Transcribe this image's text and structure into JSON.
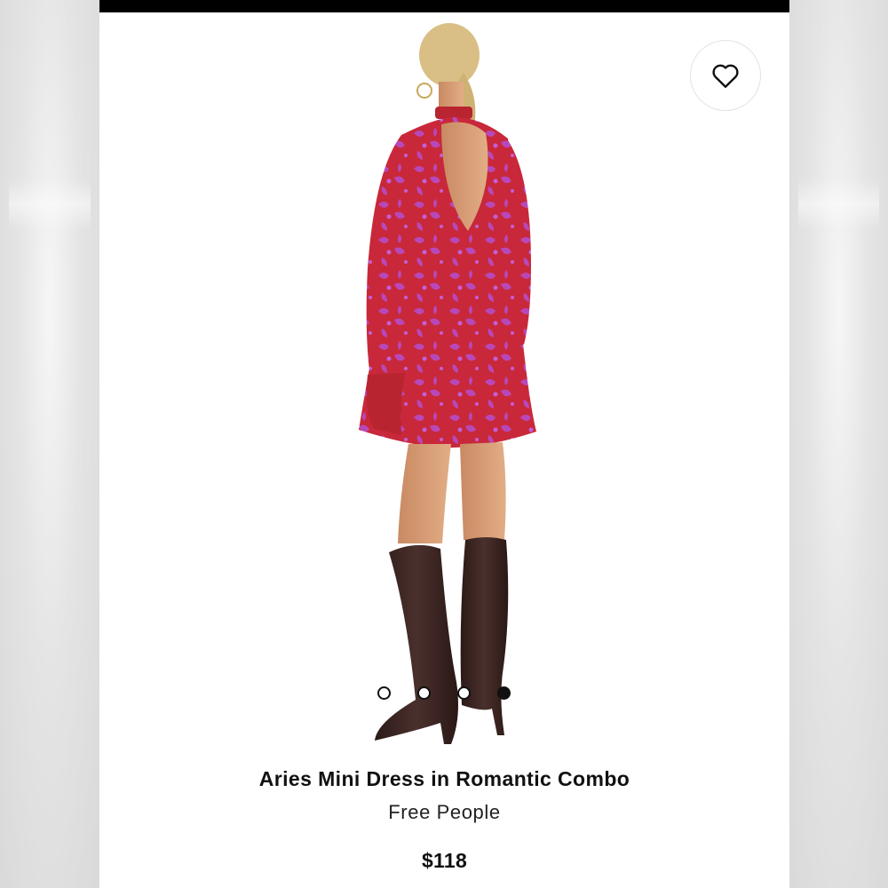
{
  "product": {
    "name": "Aries Mini Dress in Romantic Combo",
    "brand": "Free People",
    "price": "$118"
  },
  "favorite_button": {
    "icon": "heart-icon"
  },
  "carousel": {
    "total_images": 4,
    "active_index": 3
  },
  "colors": {
    "dress_red": "#c8283a",
    "dress_print": "#b64bc8",
    "boots": "#3b2522",
    "background": "#ffffff"
  }
}
